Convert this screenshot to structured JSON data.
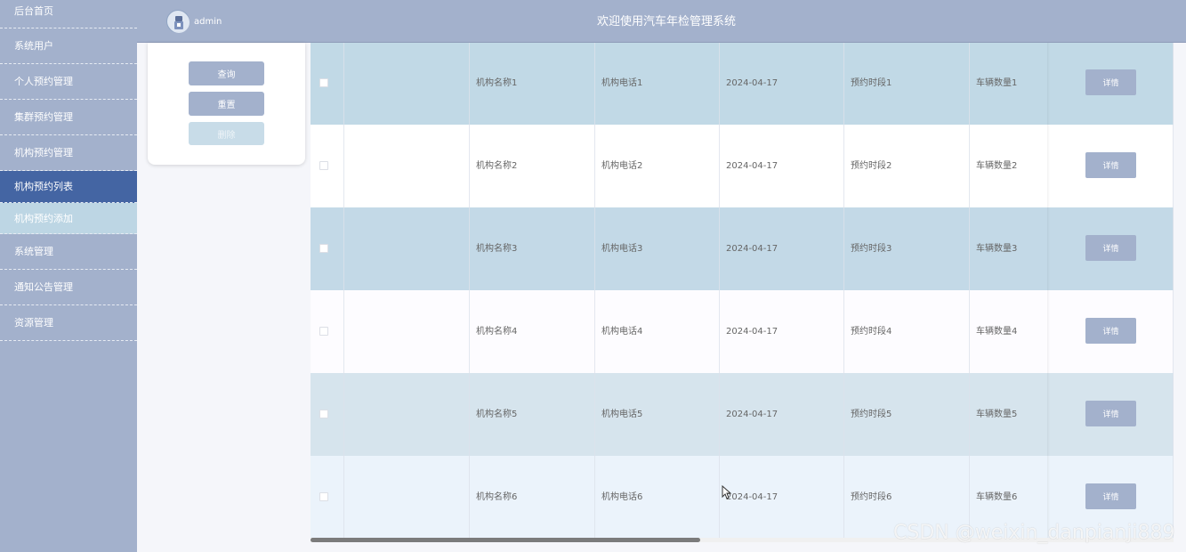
{
  "sidebar": {
    "items": [
      {
        "label": "后台首页"
      },
      {
        "label": "系统用户"
      },
      {
        "label": "个人预约管理"
      },
      {
        "label": "集群预约管理"
      },
      {
        "label": "机构预约管理"
      },
      {
        "label": "机构预约列表"
      },
      {
        "label": "机构预约添加"
      },
      {
        "label": "系统管理"
      },
      {
        "label": "通知公告管理"
      },
      {
        "label": "资源管理"
      }
    ]
  },
  "header": {
    "username": "admin",
    "title": "欢迎使用汽车年检管理系统"
  },
  "search_panel": {
    "query_label": "查询",
    "reset_label": "重置",
    "delete_label": "删除"
  },
  "table": {
    "detail_label": "详情",
    "rows": [
      {
        "name": "机构名称1",
        "phone": "机构电话1",
        "date": "2024-04-17",
        "slot": "预约时段1",
        "count": "车辆数量1",
        "bg": "#c1d9e6"
      },
      {
        "name": "机构名称2",
        "phone": "机构电话2",
        "date": "2024-04-17",
        "slot": "预约时段2",
        "count": "车辆数量2",
        "bg": "#ffffff"
      },
      {
        "name": "机构名称3",
        "phone": "机构电话3",
        "date": "2024-04-17",
        "slot": "预约时段3",
        "count": "车辆数量3",
        "bg": "#c3d9e7"
      },
      {
        "name": "机构名称4",
        "phone": "机构电话4",
        "date": "2024-04-17",
        "slot": "预约时段4",
        "count": "车辆数量4",
        "bg": "#fdfcff"
      },
      {
        "name": "机构名称5",
        "phone": "机构电话5",
        "date": "2024-04-17",
        "slot": "预约时段5",
        "count": "车辆数量5",
        "bg": "#d6e4ed"
      },
      {
        "name": "机构名称6",
        "phone": "机构电话6",
        "date": "2024-04-17",
        "slot": "预约时段6",
        "count": "车辆数量6",
        "bg": "#ebf3fb"
      }
    ]
  },
  "watermark": "CSDN @weixin_danpianji889",
  "colors": {
    "sidebar_bg": "#a3b1cc",
    "active_item": "#4465a3",
    "sub_item": "#bdd6e4",
    "button": "#a3b1cc"
  }
}
